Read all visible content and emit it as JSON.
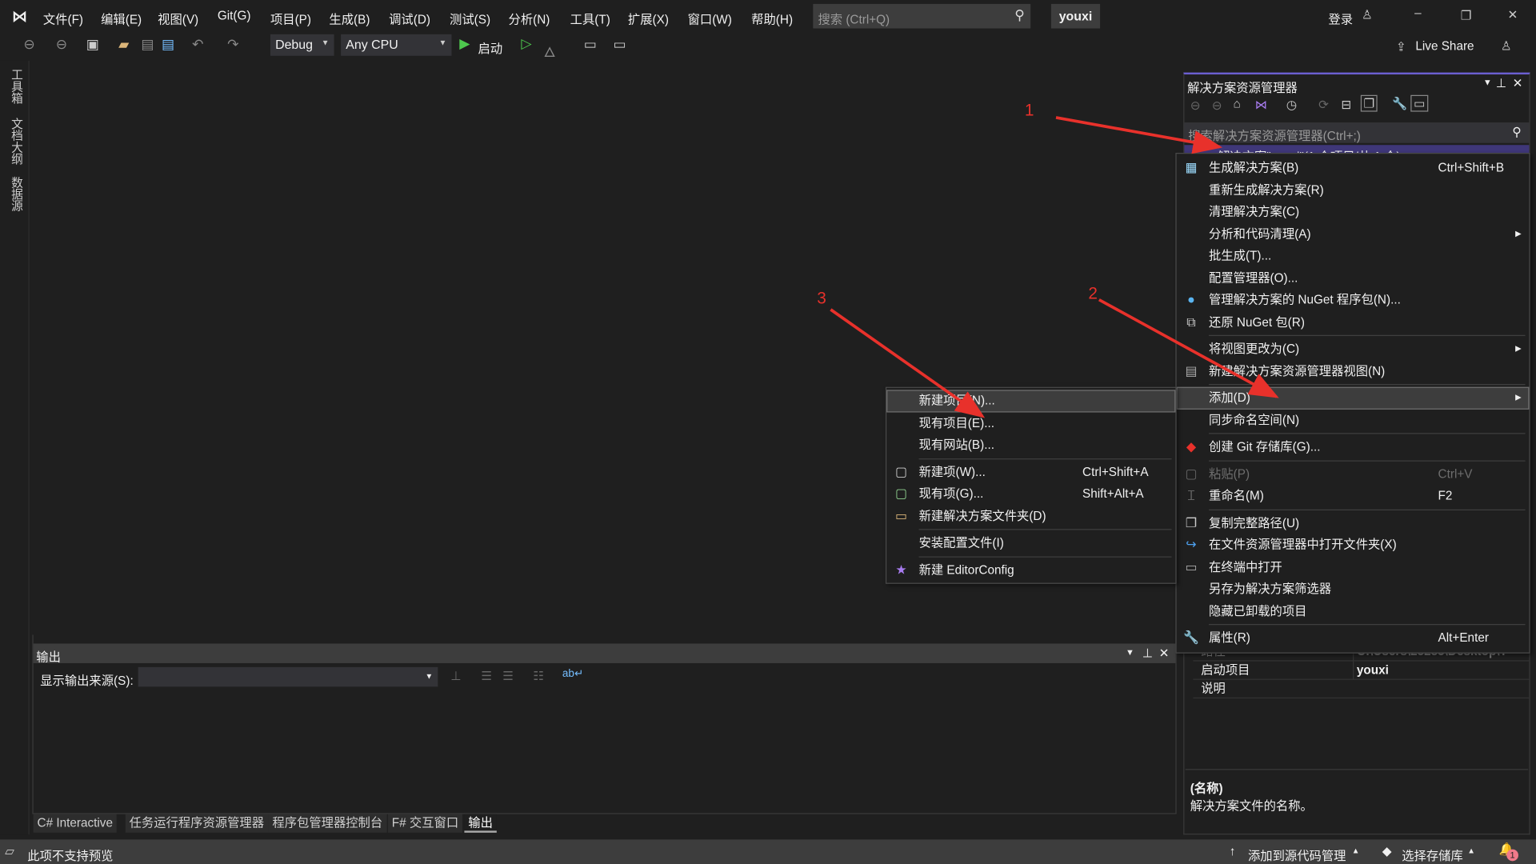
{
  "menubar": {
    "items": [
      "文件(F)",
      "编辑(E)",
      "视图(V)",
      "Git(G)",
      "项目(P)",
      "生成(B)",
      "调试(D)",
      "测试(S)",
      "分析(N)",
      "工具(T)",
      "扩展(X)",
      "窗口(W)",
      "帮助(H)"
    ],
    "search_placeholder": "搜索 (Ctrl+Q)",
    "solution_name": "youxi",
    "login": "登录"
  },
  "toolbar": {
    "config": "Debug",
    "platform": "Any CPU",
    "start": "启动",
    "live_share": "Live Share"
  },
  "left_tabs": [
    "工具箱",
    "文档大纲",
    "数据源"
  ],
  "solution_explorer": {
    "title": "解决方案资源管理器",
    "search_placeholder": "搜索解决方案资源管理器(Ctrl+;)",
    "root_item": "解决方案\"youxi\"(1 个项目/共 1 个)"
  },
  "properties": {
    "rows": [
      {
        "name": "路径",
        "value": "C:\\Users\\25285\\Desktop\\T"
      },
      {
        "name": "启动项目",
        "value": "youxi"
      },
      {
        "name": "说明",
        "value": ""
      }
    ],
    "desc_title": "(名称)",
    "desc_text": "解决方案文件的名称。"
  },
  "context_menu": {
    "items": [
      {
        "label": "生成解决方案(B)",
        "shortcut": "Ctrl+Shift+B",
        "icon": "build-icon"
      },
      {
        "label": "重新生成解决方案(R)"
      },
      {
        "label": "清理解决方案(C)"
      },
      {
        "label": "分析和代码清理(A)",
        "submenu": true
      },
      {
        "label": "批生成(T)..."
      },
      {
        "label": "配置管理器(O)..."
      },
      {
        "label": "管理解决方案的 NuGet 程序包(N)...",
        "icon": "nuget-icon"
      },
      {
        "label": "还原 NuGet 包(R)",
        "icon": "restore-icon"
      },
      {
        "sep": true
      },
      {
        "label": "将视图更改为(C)",
        "submenu": true
      },
      {
        "label": "新建解决方案资源管理器视图(N)",
        "icon": "new-view-icon"
      },
      {
        "sep": true
      },
      {
        "label": "添加(D)",
        "submenu": true,
        "highlighted": true
      },
      {
        "label": "同步命名空间(N)"
      },
      {
        "sep": true
      },
      {
        "label": "创建 Git 存储库(G)...",
        "icon": "git-icon"
      },
      {
        "sep": true
      },
      {
        "label": "粘贴(P)",
        "shortcut": "Ctrl+V",
        "disabled": true,
        "icon": "paste-icon"
      },
      {
        "label": "重命名(M)",
        "shortcut": "F2",
        "icon": "rename-icon"
      },
      {
        "sep": true
      },
      {
        "label": "复制完整路径(U)",
        "icon": "copy-icon"
      },
      {
        "label": "在文件资源管理器中打开文件夹(X)",
        "icon": "open-folder-icon"
      },
      {
        "label": "在终端中打开",
        "icon": "terminal-icon"
      },
      {
        "label": "另存为解决方案筛选器"
      },
      {
        "label": "隐藏已卸载的项目"
      },
      {
        "sep": true
      },
      {
        "label": "属性(R)",
        "shortcut": "Alt+Enter",
        "icon": "wrench-icon"
      }
    ]
  },
  "add_submenu": {
    "items": [
      {
        "label": "新建项目(N)...",
        "highlighted": true
      },
      {
        "label": "现有项目(E)..."
      },
      {
        "label": "现有网站(B)..."
      },
      {
        "sep": true
      },
      {
        "label": "新建项(W)...",
        "shortcut": "Ctrl+Shift+A",
        "icon": "new-item-icon"
      },
      {
        "label": "现有项(G)...",
        "shortcut": "Shift+Alt+A",
        "icon": "existing-item-icon"
      },
      {
        "label": "新建解决方案文件夹(D)",
        "icon": "new-folder-icon"
      },
      {
        "sep": true
      },
      {
        "label": "安装配置文件(I)"
      },
      {
        "sep": true
      },
      {
        "label": "新建 EditorConfig",
        "icon": "editorconfig-icon"
      }
    ]
  },
  "output": {
    "title": "输出",
    "source_label": "显示输出来源(S):",
    "source_value": ""
  },
  "bottom_tabs": [
    "C# Interactive",
    "任务运行程序资源管理器",
    "程序包管理器控制台",
    "F# 交互窗口",
    "输出"
  ],
  "statusbar": {
    "left": "此项不支持预览",
    "add_source": "添加到源代码管理",
    "select_repo": "选择存储库",
    "notifications": "1"
  },
  "annotations": [
    "1",
    "2",
    "3"
  ],
  "colors": {
    "accent": "#6b5fd1",
    "selection": "#3f3779",
    "annotation": "#e8312b",
    "bg": "#1f1f1f"
  }
}
